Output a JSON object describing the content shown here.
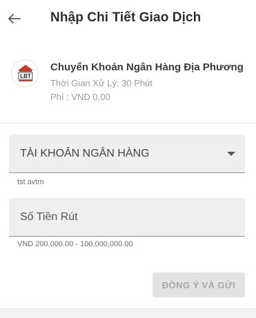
{
  "header": {
    "title": "Nhập Chi Tiết Giao Dịch",
    "back_icon": "arrow-left-icon"
  },
  "method": {
    "logo_text": "LBT",
    "name": "Chuyển Khoản Ngân Hàng Địa Phương",
    "processing_time": "Thời Gian Xử Lý: 30 Phút",
    "fee": "Phí : VND 0.00"
  },
  "form": {
    "bank_account": {
      "label": "TÀI KHOẢN NGÂN HÀNG",
      "helper": "tst avtm",
      "icon": "caret-down-icon"
    },
    "amount": {
      "placeholder": "Số Tiền Rút",
      "value": "",
      "helper": "VND 200,000.00 - 100,000,000.00"
    },
    "submit_label": "ĐỒNG Ý VÀ GỬI"
  },
  "colors": {
    "field_bg": "#efefef",
    "button_disabled_bg": "#e3e3e3",
    "button_disabled_text": "#a8a8a8",
    "logo_accent": "#c0392b"
  }
}
